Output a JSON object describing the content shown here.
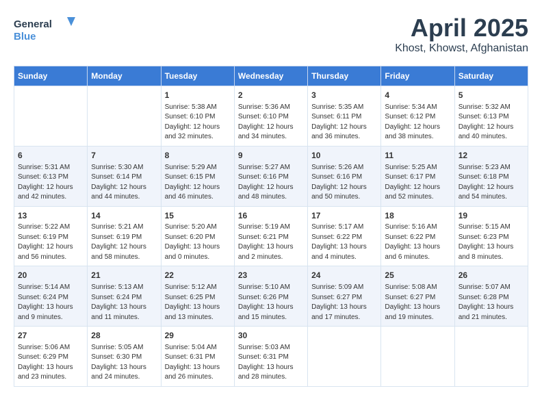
{
  "logo": {
    "line1": "General",
    "line2": "Blue"
  },
  "title": "April 2025",
  "subtitle": "Khost, Khowst, Afghanistan",
  "days_of_week": [
    "Sunday",
    "Monday",
    "Tuesday",
    "Wednesday",
    "Thursday",
    "Friday",
    "Saturday"
  ],
  "weeks": [
    [
      {
        "day": "",
        "info": ""
      },
      {
        "day": "",
        "info": ""
      },
      {
        "day": "1",
        "info": "Sunrise: 5:38 AM\nSunset: 6:10 PM\nDaylight: 12 hours\nand 32 minutes."
      },
      {
        "day": "2",
        "info": "Sunrise: 5:36 AM\nSunset: 6:10 PM\nDaylight: 12 hours\nand 34 minutes."
      },
      {
        "day": "3",
        "info": "Sunrise: 5:35 AM\nSunset: 6:11 PM\nDaylight: 12 hours\nand 36 minutes."
      },
      {
        "day": "4",
        "info": "Sunrise: 5:34 AM\nSunset: 6:12 PM\nDaylight: 12 hours\nand 38 minutes."
      },
      {
        "day": "5",
        "info": "Sunrise: 5:32 AM\nSunset: 6:13 PM\nDaylight: 12 hours\nand 40 minutes."
      }
    ],
    [
      {
        "day": "6",
        "info": "Sunrise: 5:31 AM\nSunset: 6:13 PM\nDaylight: 12 hours\nand 42 minutes."
      },
      {
        "day": "7",
        "info": "Sunrise: 5:30 AM\nSunset: 6:14 PM\nDaylight: 12 hours\nand 44 minutes."
      },
      {
        "day": "8",
        "info": "Sunrise: 5:29 AM\nSunset: 6:15 PM\nDaylight: 12 hours\nand 46 minutes."
      },
      {
        "day": "9",
        "info": "Sunrise: 5:27 AM\nSunset: 6:16 PM\nDaylight: 12 hours\nand 48 minutes."
      },
      {
        "day": "10",
        "info": "Sunrise: 5:26 AM\nSunset: 6:16 PM\nDaylight: 12 hours\nand 50 minutes."
      },
      {
        "day": "11",
        "info": "Sunrise: 5:25 AM\nSunset: 6:17 PM\nDaylight: 12 hours\nand 52 minutes."
      },
      {
        "day": "12",
        "info": "Sunrise: 5:23 AM\nSunset: 6:18 PM\nDaylight: 12 hours\nand 54 minutes."
      }
    ],
    [
      {
        "day": "13",
        "info": "Sunrise: 5:22 AM\nSunset: 6:19 PM\nDaylight: 12 hours\nand 56 minutes."
      },
      {
        "day": "14",
        "info": "Sunrise: 5:21 AM\nSunset: 6:19 PM\nDaylight: 12 hours\nand 58 minutes."
      },
      {
        "day": "15",
        "info": "Sunrise: 5:20 AM\nSunset: 6:20 PM\nDaylight: 13 hours\nand 0 minutes."
      },
      {
        "day": "16",
        "info": "Sunrise: 5:19 AM\nSunset: 6:21 PM\nDaylight: 13 hours\nand 2 minutes."
      },
      {
        "day": "17",
        "info": "Sunrise: 5:17 AM\nSunset: 6:22 PM\nDaylight: 13 hours\nand 4 minutes."
      },
      {
        "day": "18",
        "info": "Sunrise: 5:16 AM\nSunset: 6:22 PM\nDaylight: 13 hours\nand 6 minutes."
      },
      {
        "day": "19",
        "info": "Sunrise: 5:15 AM\nSunset: 6:23 PM\nDaylight: 13 hours\nand 8 minutes."
      }
    ],
    [
      {
        "day": "20",
        "info": "Sunrise: 5:14 AM\nSunset: 6:24 PM\nDaylight: 13 hours\nand 9 minutes."
      },
      {
        "day": "21",
        "info": "Sunrise: 5:13 AM\nSunset: 6:24 PM\nDaylight: 13 hours\nand 11 minutes."
      },
      {
        "day": "22",
        "info": "Sunrise: 5:12 AM\nSunset: 6:25 PM\nDaylight: 13 hours\nand 13 minutes."
      },
      {
        "day": "23",
        "info": "Sunrise: 5:10 AM\nSunset: 6:26 PM\nDaylight: 13 hours\nand 15 minutes."
      },
      {
        "day": "24",
        "info": "Sunrise: 5:09 AM\nSunset: 6:27 PM\nDaylight: 13 hours\nand 17 minutes."
      },
      {
        "day": "25",
        "info": "Sunrise: 5:08 AM\nSunset: 6:27 PM\nDaylight: 13 hours\nand 19 minutes."
      },
      {
        "day": "26",
        "info": "Sunrise: 5:07 AM\nSunset: 6:28 PM\nDaylight: 13 hours\nand 21 minutes."
      }
    ],
    [
      {
        "day": "27",
        "info": "Sunrise: 5:06 AM\nSunset: 6:29 PM\nDaylight: 13 hours\nand 23 minutes."
      },
      {
        "day": "28",
        "info": "Sunrise: 5:05 AM\nSunset: 6:30 PM\nDaylight: 13 hours\nand 24 minutes."
      },
      {
        "day": "29",
        "info": "Sunrise: 5:04 AM\nSunset: 6:31 PM\nDaylight: 13 hours\nand 26 minutes."
      },
      {
        "day": "30",
        "info": "Sunrise: 5:03 AM\nSunset: 6:31 PM\nDaylight: 13 hours\nand 28 minutes."
      },
      {
        "day": "",
        "info": ""
      },
      {
        "day": "",
        "info": ""
      },
      {
        "day": "",
        "info": ""
      }
    ]
  ]
}
